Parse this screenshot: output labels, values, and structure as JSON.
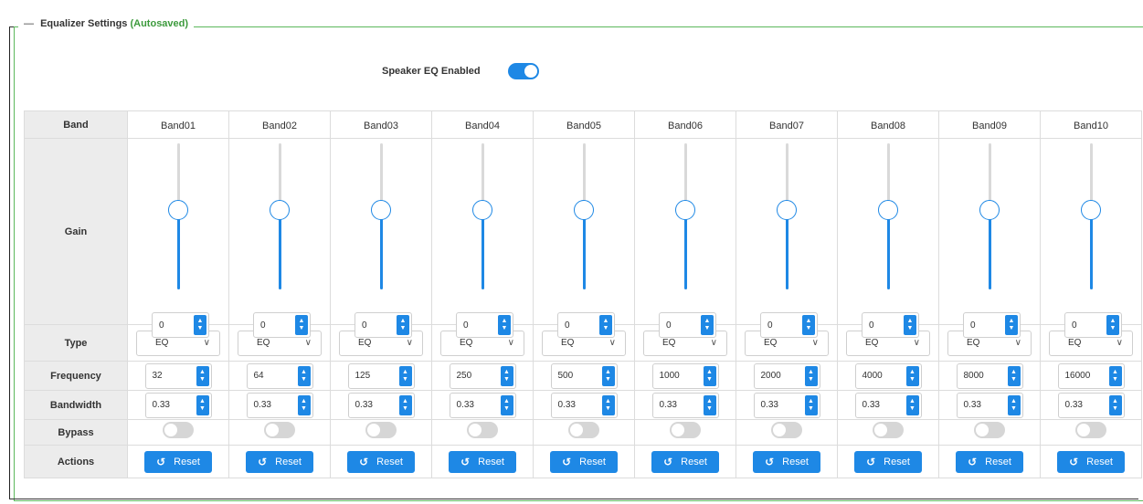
{
  "section": {
    "collapse_glyph": "—",
    "title": "Equalizer Settings",
    "status": "(Autosaved)"
  },
  "eq_enabled": {
    "label": "Speaker EQ Enabled",
    "on": true
  },
  "row_labels": {
    "band": "Band",
    "gain": "Gain",
    "type": "Type",
    "frequency": "Frequency",
    "bandwidth": "Bandwidth",
    "bypass": "Bypass",
    "actions": "Actions"
  },
  "reset_label": "Reset",
  "icons": {
    "reset": "reset-icon",
    "spinner": "spinner-arrows-icon",
    "dropdown": "chevron-down-icon"
  },
  "colors": {
    "accent": "#1e88e5",
    "frame_green": "#5cb85c",
    "autosaved": "#3c9a3c"
  },
  "bands": [
    {
      "name": "Band01",
      "gain": "0",
      "gain_level": 0.5,
      "type": "EQ",
      "frequency": "32",
      "bandwidth": "0.33",
      "bypass": false
    },
    {
      "name": "Band02",
      "gain": "0",
      "gain_level": 0.5,
      "type": "EQ",
      "frequency": "64",
      "bandwidth": "0.33",
      "bypass": false
    },
    {
      "name": "Band03",
      "gain": "0",
      "gain_level": 0.5,
      "type": "EQ",
      "frequency": "125",
      "bandwidth": "0.33",
      "bypass": false
    },
    {
      "name": "Band04",
      "gain": "0",
      "gain_level": 0.5,
      "type": "EQ",
      "frequency": "250",
      "bandwidth": "0.33",
      "bypass": false
    },
    {
      "name": "Band05",
      "gain": "0",
      "gain_level": 0.5,
      "type": "EQ",
      "frequency": "500",
      "bandwidth": "0.33",
      "bypass": false
    },
    {
      "name": "Band06",
      "gain": "0",
      "gain_level": 0.5,
      "type": "EQ",
      "frequency": "1000",
      "bandwidth": "0.33",
      "bypass": false
    },
    {
      "name": "Band07",
      "gain": "0",
      "gain_level": 0.5,
      "type": "EQ",
      "frequency": "2000",
      "bandwidth": "0.33",
      "bypass": false
    },
    {
      "name": "Band08",
      "gain": "0",
      "gain_level": 0.5,
      "type": "EQ",
      "frequency": "4000",
      "bandwidth": "0.33",
      "bypass": false
    },
    {
      "name": "Band09",
      "gain": "0",
      "gain_level": 0.5,
      "type": "EQ",
      "frequency": "8000",
      "bandwidth": "0.33",
      "bypass": false
    },
    {
      "name": "Band10",
      "gain": "0",
      "gain_level": 0.5,
      "type": "EQ",
      "frequency": "16000",
      "bandwidth": "0.33",
      "bypass": false
    }
  ]
}
